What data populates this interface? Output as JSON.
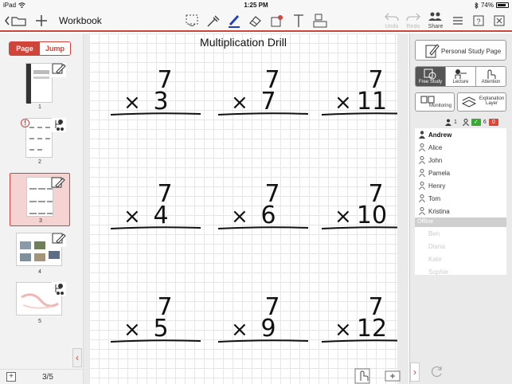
{
  "status": {
    "device": "iPad",
    "time": "1:25 PM",
    "battery": "74%"
  },
  "toolbar": {
    "title": "Workbook",
    "undo": "Undo",
    "redo": "Redo",
    "share": "Share",
    "icons": [
      "back-icon",
      "folder-icon",
      "add-icon",
      "lasso-icon",
      "eyedropper-icon",
      "pen-icon",
      "eraser-icon",
      "stamp-icon",
      "text-icon",
      "shapes-icon",
      "undo-icon",
      "redo-icon",
      "share-icon",
      "menu-icon",
      "help-icon",
      "fullscreen-icon"
    ]
  },
  "left_panel": {
    "tab_page": "Page",
    "tab_jump": "Jump",
    "thumbnails": [
      {
        "num": "1"
      },
      {
        "num": "2"
      },
      {
        "num": "3"
      },
      {
        "num": "4"
      },
      {
        "num": "5"
      }
    ],
    "page_counter": "3/5"
  },
  "sheet": {
    "title": "Multiplication Drill",
    "problems": [
      {
        "top": "7",
        "bottom": "3"
      },
      {
        "top": "7",
        "bottom": "7"
      },
      {
        "top": "7",
        "bottom": "11"
      },
      {
        "top": "7",
        "bottom": "4"
      },
      {
        "top": "7",
        "bottom": "6"
      },
      {
        "top": "7",
        "bottom": "10"
      },
      {
        "top": "7",
        "bottom": "5"
      },
      {
        "top": "7",
        "bottom": "9"
      },
      {
        "top": "7",
        "bottom": "12"
      }
    ],
    "operator": "×"
  },
  "right_panel": {
    "personal_study_page": "Personal Study Page",
    "modes": [
      "Free Study",
      "Lecture",
      "Attention"
    ],
    "monitoring": "Monitoring",
    "explanation_layer": "Explanation Layer",
    "counts": {
      "online": "1",
      "submitted": "6",
      "pending": "0"
    },
    "users": [
      {
        "name": "Andrew",
        "me": true
      },
      {
        "name": "Alice"
      },
      {
        "name": "John"
      },
      {
        "name": "Pamela"
      },
      {
        "name": "Henry"
      },
      {
        "name": "Tom"
      },
      {
        "name": "Kristina"
      }
    ],
    "offline_header": "Offline",
    "offline_users": [
      "Ben",
      "Diana",
      "Kate",
      "Sophie"
    ]
  },
  "colors": {
    "accent": "#d0453a",
    "green": "#3aa832",
    "red": "#e2452f",
    "pen": "#1f3fbf"
  }
}
